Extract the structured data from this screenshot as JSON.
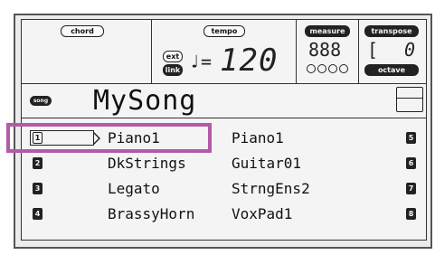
{
  "header": {
    "chord_label": "chord",
    "tempo_label": "tempo",
    "ext_label": "ext",
    "link_label": "link",
    "tempo_symbol": "♩=",
    "tempo_value": "120",
    "measure_label": "measure",
    "measure_value": "888",
    "transpose_label": "transpose",
    "transpose_bracket": "[",
    "transpose_value": "0",
    "octave_label": "octave"
  },
  "song": {
    "icon_label": "song",
    "name": "MySong"
  },
  "tracks": [
    {
      "num": "1",
      "name": "Piano1"
    },
    {
      "num": "2",
      "name": "DkStrings"
    },
    {
      "num": "3",
      "name": "Legato"
    },
    {
      "num": "4",
      "name": "BrassyHorn"
    },
    {
      "num": "5",
      "name": "Piano1"
    },
    {
      "num": "6",
      "name": "Guitar01"
    },
    {
      "num": "7",
      "name": "StrngEns2"
    },
    {
      "num": "8",
      "name": "VoxPad1"
    }
  ],
  "colors": {
    "highlight": "#b35aa8",
    "lcd_background": "#f4f4f4"
  }
}
